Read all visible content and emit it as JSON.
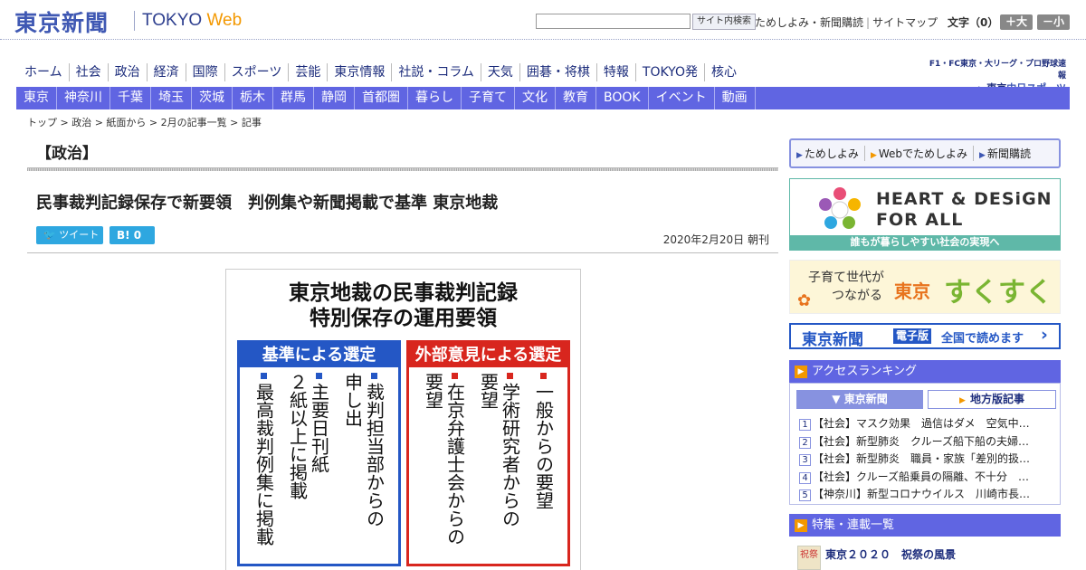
{
  "header": {
    "logo_jp": "東京新聞",
    "logo_en_main": "TOKYO ",
    "logo_en_web": "Web",
    "search_button": "サイト内検索",
    "links": [
      "ためしよみ・新聞購読",
      "サイトマップ"
    ],
    "font_size_label": "文字（0）",
    "font_large": "＋大",
    "font_small": "－小"
  },
  "nav_main": [
    "ホーム",
    "社会",
    "政治",
    "経済",
    "国際",
    "スポーツ",
    "芸能",
    "東京情報",
    "社説・コラム",
    "天気",
    "囲碁・将棋",
    "特報",
    "TOKYO発",
    "核心"
  ],
  "promo": {
    "line1": "F1・FC東京・大リーグ・プロ野球速報",
    "line2_pre": "東京",
    "line2_brand": "中日スポーツ"
  },
  "nav_sub": [
    "東京",
    "神奈川",
    "千葉",
    "埼玉",
    "茨城",
    "栃木",
    "群馬",
    "静岡",
    "首都圏",
    "暮らし",
    "子育て",
    "文化",
    "教育",
    "BOOK",
    "イベント",
    "動画"
  ],
  "breadcrumb": "トップ > 政治 > 紙面から > 2月の記事一覧 > 記事",
  "article": {
    "section": "【政治】",
    "headline": "民事裁判記録保存で新要領　判例集や新聞掲載で基準 東京地裁",
    "tweet": "ツイート",
    "hatena": "B! 0",
    "date": "2020年2月20日 朝刊"
  },
  "figure": {
    "title_line1": "東京地裁の民事裁判記録",
    "title_line2": "特別保存の運用要領",
    "left_head": "基準による選定",
    "left_cols": [
      "裁判担当部からの\n申し出",
      "主要日刊紙\n２紙以上に掲載",
      "最高裁判例集に掲載"
    ],
    "right_head": "外部意見による選定",
    "right_cols": [
      "一般からの要望",
      "学術研究者からの\n要望",
      "在京弁護士会からの\n要望"
    ]
  },
  "sidebar": {
    "links": [
      "ためしよみ",
      "Webでためしよみ",
      "新聞購読"
    ],
    "hd_line1": "HEART & DESiGN",
    "hd_line2": "FOR ALL",
    "hd_foot": "誰もが暮らしやすい社会の実現へ",
    "sk_line1": "子育て世代が",
    "sk_line2": "つながる",
    "sk_tokyo": "東京",
    "sk_sukusuku": "すくすく",
    "eb_name": "東京新聞",
    "eb_badge": "電子版",
    "eb_text": "全国で読めます",
    "ranking_head": "アクセスランキング",
    "ranking_tab1": "東京新聞",
    "ranking_tab2": "地方版記事",
    "ranking": [
      {
        "n": "1",
        "t": "【社会】マスク効果　過信はダメ　空気中…"
      },
      {
        "n": "2",
        "t": "【社会】新型肺炎　クルーズ船下船の夫婦…"
      },
      {
        "n": "3",
        "t": "【社会】新型肺炎　職員・家族「差別的扱…"
      },
      {
        "n": "4",
        "t": "【社会】クルーズ船乗員の隔離、不十分　…"
      },
      {
        "n": "5",
        "t": "【神奈川】新型コロナウイルス　川崎市長…"
      }
    ],
    "feature_head": "特集・連載一覧",
    "feature_title": "東京２０２０　祝祭の風景",
    "feature_thumb": "祝祭"
  },
  "colors": {
    "brand": "#3f58b3",
    "nav_sub_bg": "#6065e2",
    "accent": "#f39800",
    "fig_blue": "#2457c5",
    "fig_red": "#d8261e"
  }
}
